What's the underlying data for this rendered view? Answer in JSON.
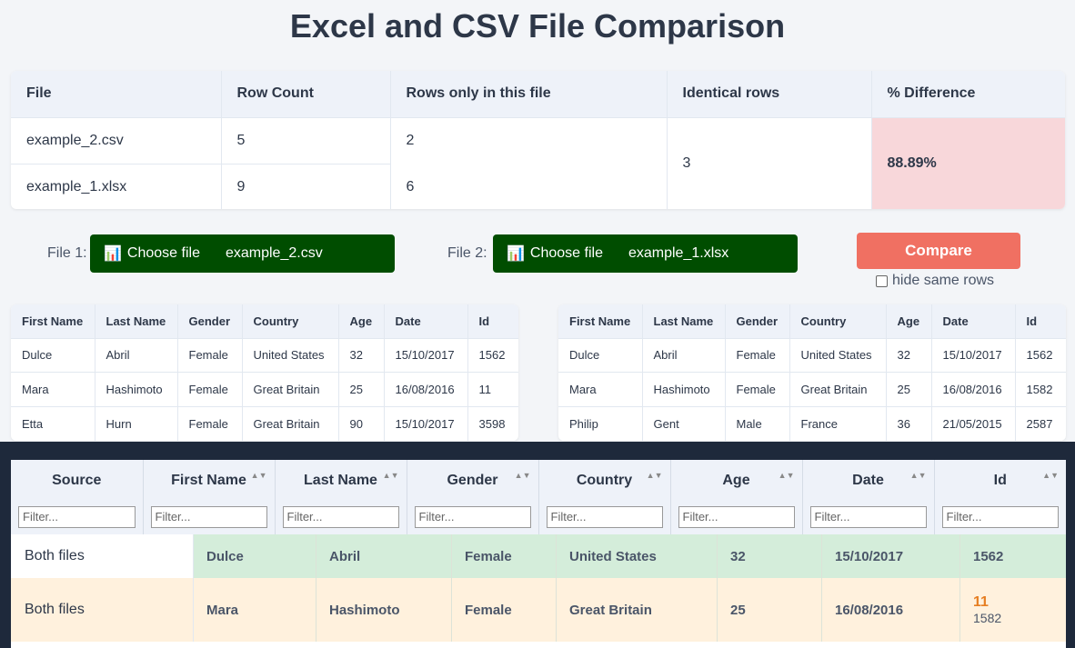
{
  "title": "Excel and CSV File Comparison",
  "summary": {
    "headers": [
      "File",
      "Row Count",
      "Rows only in this file",
      "Identical rows",
      "% Difference"
    ],
    "rows": [
      {
        "file": "example_2.csv",
        "count": "5",
        "only": "2"
      },
      {
        "file": "example_1.xlsx",
        "count": "9",
        "only": "6"
      }
    ],
    "identical": "3",
    "difference": "88.89%"
  },
  "pickers": {
    "file1_label": "File 1:",
    "file2_label": "File 2:",
    "choose_label": "Choose file",
    "file1_name": "example_2.csv",
    "file2_name": "example_1.xlsx",
    "icon": "chart-icon",
    "compare_label": "Compare",
    "hide_label": "hide same rows"
  },
  "preview": {
    "headers": [
      "First Name",
      "Last Name",
      "Gender",
      "Country",
      "Age",
      "Date",
      "Id"
    ],
    "left_rows": [
      [
        "Dulce",
        "Abril",
        "Female",
        "United States",
        "32",
        "15/10/2017",
        "1562"
      ],
      [
        "Mara",
        "Hashimoto",
        "Female",
        "Great Britain",
        "25",
        "16/08/2016",
        "11"
      ],
      [
        "Etta",
        "Hurn",
        "Female",
        "Great Britain",
        "90",
        "15/10/2017",
        "3598"
      ]
    ],
    "right_rows": [
      [
        "Dulce",
        "Abril",
        "Female",
        "United States",
        "32",
        "15/10/2017",
        "1562"
      ],
      [
        "Mara",
        "Hashimoto",
        "Female",
        "Great Britain",
        "25",
        "16/08/2016",
        "1582"
      ],
      [
        "Philip",
        "Gent",
        "Male",
        "France",
        "36",
        "21/05/2015",
        "2587"
      ]
    ]
  },
  "results": {
    "headers": [
      "Source",
      "First Name",
      "Last Name",
      "Gender",
      "Country",
      "Age",
      "Date",
      "Id"
    ],
    "filter_placeholder": "Filter...",
    "rows": [
      {
        "source": "Both files",
        "cells": [
          "Dulce",
          "Abril",
          "Female",
          "United States",
          "32",
          "15/10/2017",
          "1562"
        ]
      },
      {
        "source": "Both files",
        "cells": [
          "Mara",
          "Hashimoto",
          "Female",
          "Great Britain",
          "25",
          "16/08/2016"
        ],
        "id_new": "11",
        "id_old": "1582"
      }
    ]
  },
  "colors": {
    "accent_dark_green": "#004d00",
    "compare": "#f07062",
    "diff_pct": "#f8d7da",
    "row_same": "#d4edda",
    "row_changed": "#fff1dd",
    "changed_value": "#e67e22"
  }
}
